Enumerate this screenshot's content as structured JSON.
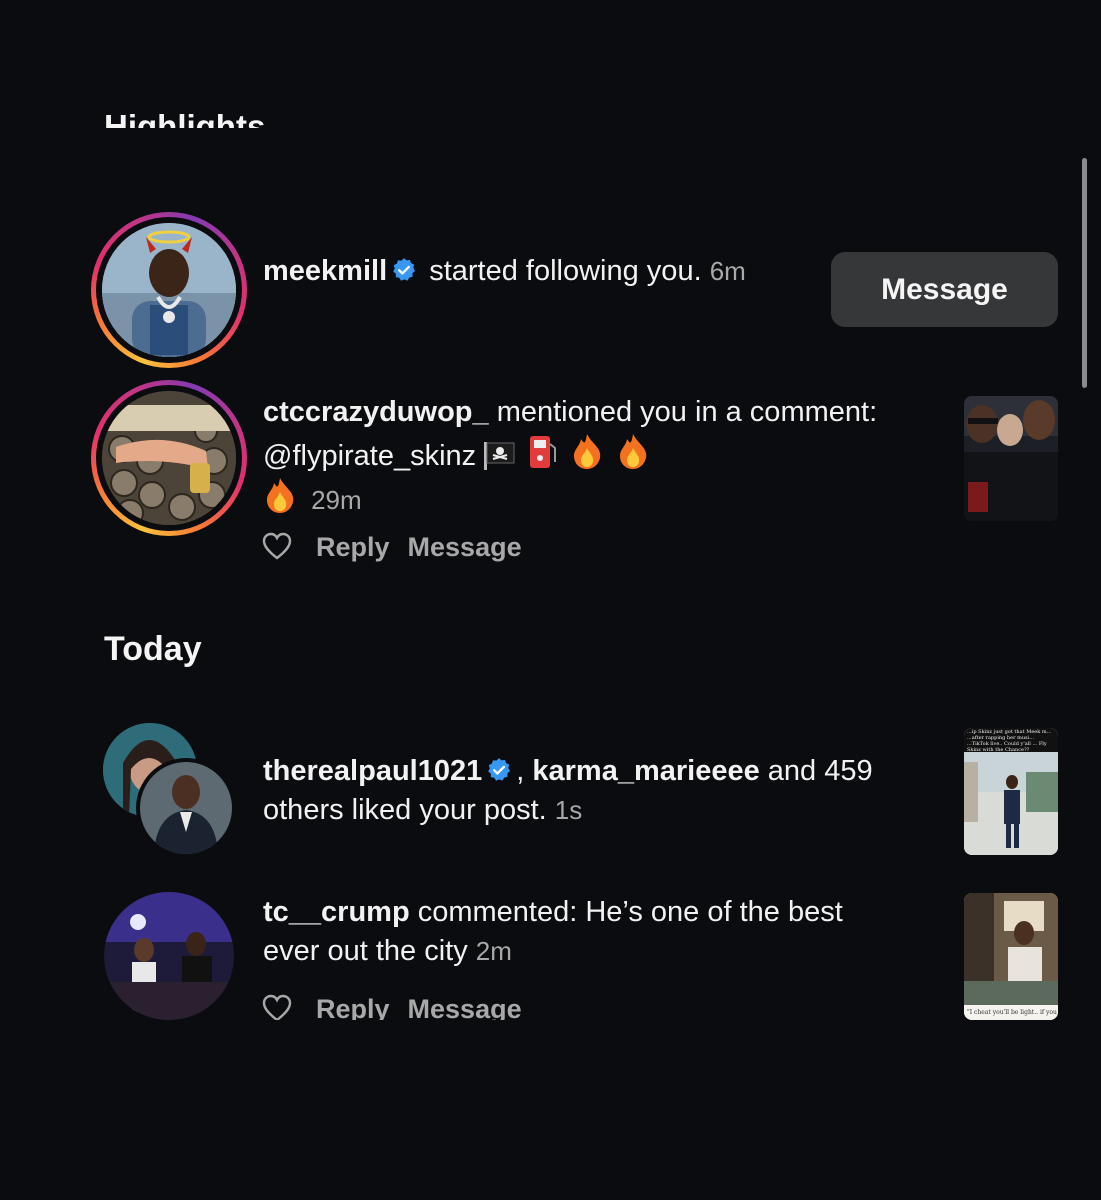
{
  "highlights": {
    "title": "Highlights"
  },
  "today": {
    "title": "Today"
  },
  "notifications": {
    "follow": {
      "username": "meekmill",
      "text": " started following you.",
      "time": "6m",
      "button_label": "Message"
    },
    "mention": {
      "username": "ctccrazyduwop_",
      "text": " mentioned you in a comment: @flypirate_skinz",
      "time": "29m",
      "reply_label": "Reply",
      "message_label": "Message"
    },
    "likes": {
      "username1": "therealpaul1021",
      "sep": ", ",
      "username2": "karma_marieeee",
      "text": " and 459 others liked your post.",
      "time": "1s"
    },
    "comment": {
      "username": "tc__crump",
      "text": " commented: He’s one of the best ever out the city",
      "time": "2m",
      "reply_label": "Reply",
      "message_label": "Message"
    }
  },
  "thumbnails": {
    "likes_caption": "...ip Skinz just got that Meek m... ...after rapping her musi... ...TikTok live.. Could y'all ... Fly Skinz with the Chance??",
    "comment_caption": "\"I cheat you'll be light.. if you"
  },
  "colors": {
    "background": "#0b0c10",
    "verified": "#3897f0",
    "button": "#363739",
    "secondary_text": "#a8a8a8"
  },
  "icons": [
    "verified-badge-icon",
    "heart-icon",
    "pirate-flag-icon",
    "fuel-pump-icon",
    "fire-icon"
  ]
}
